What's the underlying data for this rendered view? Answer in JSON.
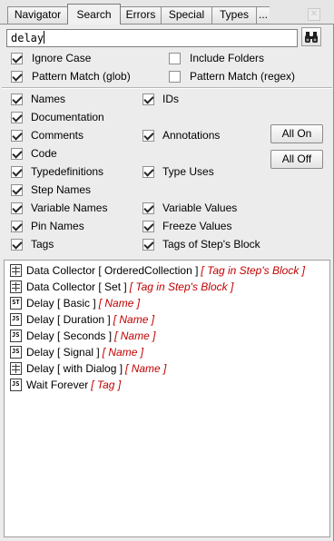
{
  "tabs": [
    {
      "label": "Navigator",
      "active": false
    },
    {
      "label": "Search",
      "active": true
    },
    {
      "label": "Errors",
      "active": false
    },
    {
      "label": "Special",
      "active": false
    },
    {
      "label": "Types",
      "active": false
    },
    {
      "label": "...",
      "active": false
    }
  ],
  "search": {
    "value": "delay",
    "button_icon": "binoculars-icon"
  },
  "options": {
    "ignore_case": {
      "label": "Ignore Case",
      "checked": true
    },
    "include_folders": {
      "label": "Include Folders",
      "checked": false
    },
    "pattern_glob": {
      "label": "Pattern Match (glob)",
      "checked": true
    },
    "pattern_regex": {
      "label": "Pattern Match (regex)",
      "checked": false
    }
  },
  "filters": {
    "names": {
      "label": "Names",
      "checked": true
    },
    "ids": {
      "label": "IDs",
      "checked": true
    },
    "documentation": {
      "label": "Documentation",
      "checked": true
    },
    "comments": {
      "label": "Comments",
      "checked": true
    },
    "annotations": {
      "label": "Annotations",
      "checked": true
    },
    "code": {
      "label": "Code",
      "checked": true
    },
    "typedefinitions": {
      "label": "Typedefinitions",
      "checked": true
    },
    "type_uses": {
      "label": "Type Uses",
      "checked": true
    },
    "step_names": {
      "label": "Step Names",
      "checked": true
    },
    "variable_names": {
      "label": "Variable Names",
      "checked": true
    },
    "variable_values": {
      "label": "Variable Values",
      "checked": true
    },
    "pin_names": {
      "label": "Pin Names",
      "checked": true
    },
    "freeze_values": {
      "label": "Freeze Values",
      "checked": true
    },
    "tags": {
      "label": "Tags",
      "checked": true
    },
    "tags_of_steps_block": {
      "label": "Tags of Step's Block",
      "checked": true
    }
  },
  "buttons": {
    "all_on": "All On",
    "all_off": "All Off"
  },
  "results": [
    {
      "icon": "grid",
      "name": "Data Collector [ OrderedCollection ]",
      "tag": "[ Tag in Step's Block ]"
    },
    {
      "icon": "grid",
      "name": "Data Collector [ Set ]",
      "tag": "[ Tag in Step's Block ]"
    },
    {
      "icon": "st",
      "name": "Delay [ Basic ]",
      "tag": "[ Name ]"
    },
    {
      "icon": "js",
      "name": "Delay [ Duration ]",
      "tag": "[ Name ]"
    },
    {
      "icon": "js",
      "name": "Delay [ Seconds ]",
      "tag": "[ Name ]"
    },
    {
      "icon": "js",
      "name": "Delay [ Signal ]",
      "tag": "[ Name ]"
    },
    {
      "icon": "grid",
      "name": "Delay [ with Dialog ]",
      "tag": "[ Name ]"
    },
    {
      "icon": "js",
      "name": "Wait Forever",
      "tag": "[ Tag ]"
    }
  ],
  "colors": {
    "match_tag": "#c00000",
    "panel_bg": "#ececec"
  }
}
